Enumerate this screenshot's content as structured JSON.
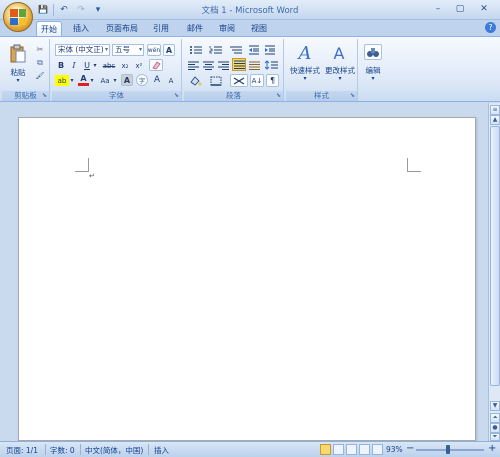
{
  "window": {
    "title": "文档 1 - Microsoft Word",
    "minimize": "–",
    "maximize": "▢",
    "close": "✕"
  },
  "qat": {
    "save": "💾",
    "undo": "↶",
    "redo": "↷",
    "customize": "▾"
  },
  "tabs": [
    {
      "label": "开始",
      "active": true
    },
    {
      "label": "插入"
    },
    {
      "label": "页面布局"
    },
    {
      "label": "引用"
    },
    {
      "label": "邮件"
    },
    {
      "label": "审阅"
    },
    {
      "label": "视图"
    }
  ],
  "ribbon": {
    "clipboard": {
      "label": "剪贴板",
      "paste": "粘贴",
      "cut": "✂",
      "copy": "⧉",
      "format_painter": "🖌"
    },
    "font": {
      "label": "字体",
      "font_name": "宋体 (中文正)",
      "font_size": "五号",
      "pinyin": "wén",
      "char_border": "A",
      "bold": "B",
      "italic": "I",
      "underline": "U",
      "strike": "abc",
      "subscript": "x₂",
      "superscript": "x²",
      "clear": "A",
      "highlight": "ab",
      "font_color": "A",
      "change_case": "Aa",
      "char_shading": "A",
      "enclose": "字",
      "grow": "A",
      "shrink": "A"
    },
    "paragraph": {
      "label": "段落"
    },
    "styles": {
      "label": "样式",
      "quick_styles": "快速样式",
      "change_styles": "更改样式"
    },
    "editing": {
      "label": "编辑"
    }
  },
  "document": {
    "paragraph_mark": "↵"
  },
  "status": {
    "page": "页面: 1/1",
    "words": "字数: 0",
    "language": "中文(简体，中国)",
    "mode": "插入",
    "zoom": "93%",
    "zoom_out": "−",
    "zoom_in": "+"
  },
  "colors": {
    "accent": "#15428b",
    "ribbon_bg": "#dde8f7",
    "highlight_yellow": "#ffff00",
    "font_red": "#e02020"
  }
}
